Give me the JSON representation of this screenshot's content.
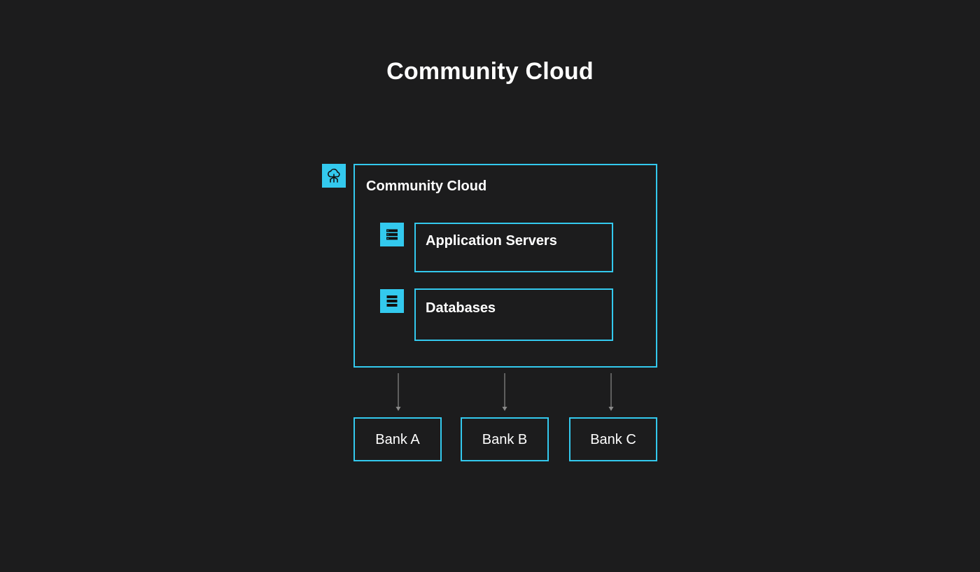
{
  "diagram": {
    "title": "Community Cloud",
    "container": {
      "label": "Community Cloud",
      "icon": "cloud-network-icon",
      "components": [
        {
          "label": "Application Servers",
          "icon": "server-icon"
        },
        {
          "label": "Databases",
          "icon": "database-icon"
        }
      ]
    },
    "banks": [
      {
        "label": "Bank A"
      },
      {
        "label": "Bank B"
      },
      {
        "label": "Bank C"
      }
    ],
    "colors": {
      "background": "#1c1c1d",
      "accent": "#33c9ee",
      "text": "#ffffff",
      "arrow": "#8a8a8a"
    }
  }
}
